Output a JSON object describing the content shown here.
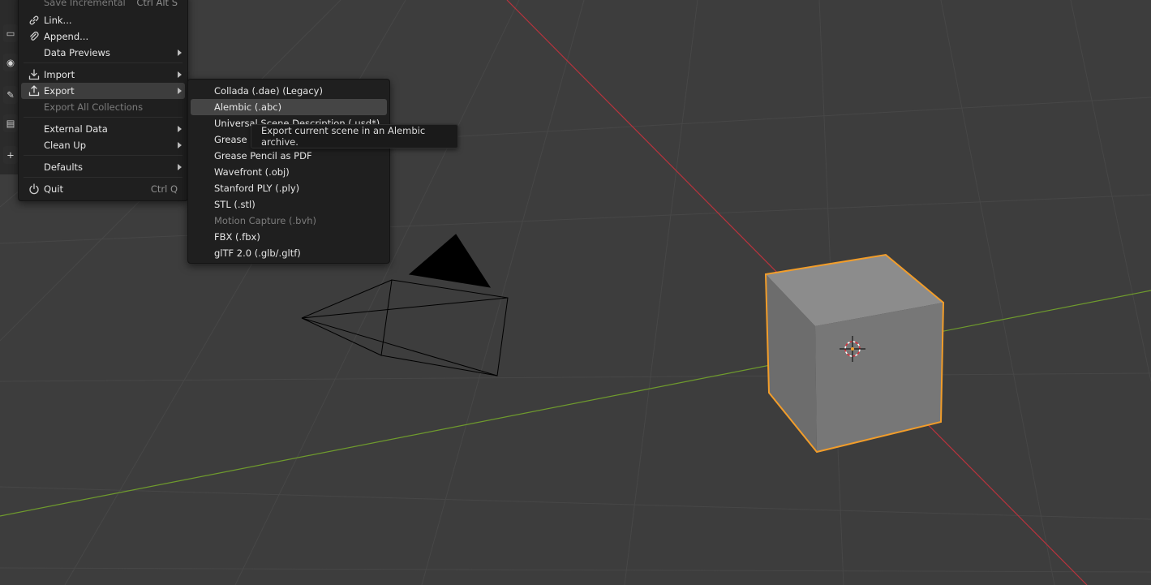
{
  "file_menu": {
    "items": [
      {
        "label": "Save Incremental",
        "shortcut": "Ctrl Alt S",
        "icon": "save-incremental-icon",
        "disabled": true
      },
      {
        "label": "Link...",
        "icon": "link-icon"
      },
      {
        "label": "Append...",
        "icon": "append-icon"
      },
      {
        "label": "Data Previews",
        "submenu": true
      },
      {
        "label": "Import",
        "icon": "import-icon",
        "submenu": true
      },
      {
        "label": "Export",
        "icon": "export-icon",
        "submenu": true,
        "active": true
      },
      {
        "label": "Export All Collections",
        "disabled": true
      },
      {
        "label": "External Data",
        "submenu": true
      },
      {
        "label": "Clean Up",
        "submenu": true
      },
      {
        "label": "Defaults",
        "submenu": true
      },
      {
        "label": "Quit",
        "shortcut": "Ctrl Q",
        "icon": "power-icon"
      }
    ]
  },
  "export_menu": {
    "items": [
      {
        "label": "Collada (.dae) (Legacy)"
      },
      {
        "label": "Alembic (.abc)",
        "selected": true
      },
      {
        "label": "Universal Scene Description (.usd*)"
      },
      {
        "label": "Grease Pencil as SVG"
      },
      {
        "label": "Grease Pencil as PDF"
      },
      {
        "label": "Wavefront (.obj)"
      },
      {
        "label": "Stanford PLY (.ply)"
      },
      {
        "label": "STL (.stl)"
      },
      {
        "label": "Motion Capture (.bvh)",
        "disabled": true
      },
      {
        "label": "FBX (.fbx)"
      },
      {
        "label": "glTF 2.0 (.glb/.gltf)"
      }
    ]
  },
  "tooltip": {
    "text": "Export current scene in an Alembic archive."
  },
  "colors": {
    "viewport_bg": "#3d3d3d",
    "grid_line": "#454545",
    "x_axis": "#b8333d",
    "y_axis": "#6f9b2d",
    "selection_outline": "#f29d2a",
    "cube_front": "#767676",
    "cube_top": "#8c8c8c",
    "cube_right": "#6b6b6b"
  },
  "scene": {
    "objects": [
      "camera",
      "cube"
    ],
    "selected_object": "cube"
  }
}
